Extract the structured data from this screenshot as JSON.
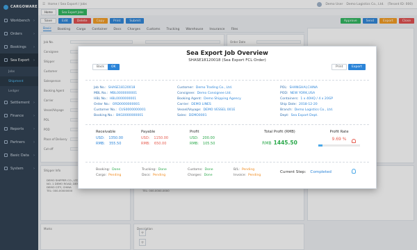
{
  "app": {
    "logo_text": "CARGOWARE"
  },
  "sidebar": {
    "items": [
      {
        "label": "Workbench",
        "active": false
      },
      {
        "label": "Orders",
        "active": false
      },
      {
        "label": "Bookings",
        "active": false
      },
      {
        "label": "Sea Export",
        "active": true
      },
      {
        "label": "Jobs",
        "active": false,
        "sub": true
      },
      {
        "label": "Shipment",
        "active": true,
        "sub": true
      },
      {
        "label": "Ledger",
        "active": false,
        "sub": true
      },
      {
        "label": "Settlement",
        "active": false
      },
      {
        "label": "Finance",
        "active": false
      },
      {
        "label": "Reports",
        "active": false
      },
      {
        "label": "Partners",
        "active": false
      },
      {
        "label": "Basic Data",
        "active": false
      },
      {
        "label": "System",
        "active": false
      }
    ]
  },
  "topbar": {
    "breadcrumb": "Home / Sea Export / Jobs",
    "user": "Demo User",
    "company": "Demo Logistics Co., Ltd.",
    "tenant": "(Tenant ID: 000)"
  },
  "tabstrip": {
    "tabs": [
      {
        "label": "Home",
        "active": false
      },
      {
        "label": "Sea Export Jobs",
        "active": true
      }
    ]
  },
  "toolbar": {
    "left": [
      {
        "label": "Save",
        "style": "b-white"
      },
      {
        "label": "Edit",
        "style": "b-blue"
      },
      {
        "label": "Delete",
        "style": "b-red"
      },
      {
        "label": "Copy",
        "style": "b-orange"
      },
      {
        "label": "Print",
        "style": "b-blue"
      },
      {
        "label": "Submit",
        "style": "b-blue"
      }
    ],
    "right": [
      {
        "label": "Approve",
        "style": "b-green"
      },
      {
        "label": "Send",
        "style": "b-blue"
      },
      {
        "label": "Export",
        "style": "b-orange"
      },
      {
        "label": "Close",
        "style": "b-red"
      }
    ]
  },
  "subtabs": [
    "Basic",
    "Booking",
    "Cargo",
    "Container",
    "Docs",
    "Charges",
    "Customs",
    "Trucking",
    "Warehouse",
    "Insurance",
    "Files"
  ],
  "form": {
    "labels": [
      "Job No.",
      "Consignee",
      "Shipper",
      "Customer",
      "Salesperson",
      "Booking Agent",
      "Carrier",
      "Vessel/Voyage",
      "POL",
      "POD",
      "Place of Delivery",
      "Cut-off"
    ],
    "right_labels": [
      "Order Date",
      "Pickup Date",
      "Ship Date",
      "ETA",
      "Terms",
      "Remarks"
    ],
    "shipper_label": "Shipper Info",
    "shipper_text": "DEMO SHIPPER CO., LTD.\nNO. 1 DEMO ROAD, DEMO DISTRICT\nDEMO CITY, CHINA\nTEL: 000-00000000",
    "consignee_label": "Consignee Info",
    "consignee_text": "DEMO CONSIGNEE CO., LTD.\nNO. 2 DEMO STREET\nDEMO CITY, USA\nTEL: 000-0000-0000",
    "notify_label": "Notify Party",
    "notify_text": "SAME AS CONSIGNEE",
    "marks_label": "Marks",
    "desc_label": "Description"
  },
  "modal": {
    "title": "Sea Export Job Overview",
    "subtitle": "SHASE18120018 (Sea Export FCL Order)",
    "back_label": "Back",
    "confirm_label": "OK",
    "print_label": "Print",
    "export_label": "Export",
    "info": {
      "col1": [
        {
          "k": "Job No.:",
          "v": "SHASE18120018"
        },
        {
          "k": "MBL No.:",
          "v": "MBL0000000001"
        },
        {
          "k": "HBL No.:",
          "v": "HBL0000000001"
        },
        {
          "k": "Order No.:",
          "v": "ORD0000000001"
        },
        {
          "k": "Customer No.:",
          "v": "CUS0000000001"
        },
        {
          "k": "Booking No.:",
          "v": "BKG0000000001"
        }
      ],
      "col2": [
        {
          "k": "Customer:",
          "v": "Demo Trading Co., Ltd."
        },
        {
          "k": "Consignee:",
          "v": "Demo Consignee Ltd."
        },
        {
          "k": "Booking Agent:",
          "v": "Demo Shipping Agency"
        },
        {
          "k": "Carrier:",
          "v": "DEMO LINES"
        },
        {
          "k": "Vessel/Voyage:",
          "v": "DEMO VESSEL 001E"
        },
        {
          "k": "Sales:",
          "v": "DEMO0001"
        }
      ],
      "col3": [
        {
          "k": "POL:",
          "v": "SHANGHAI,CHINA"
        },
        {
          "k": "POD:",
          "v": "NEW YORK,USA"
        },
        {
          "k": "Containers:",
          "v": "1 x 40HQ / 4 x 20GP"
        },
        {
          "k": "Ship Date:",
          "v": "2018-12-20"
        },
        {
          "k": "Branch:",
          "v": "Demo Logistics Co., Ltd."
        },
        {
          "k": "Dept:",
          "v": "Sea Export Dept."
        }
      ]
    },
    "finance": {
      "receivable": {
        "title": "Receivable",
        "usd_label": "USD",
        "usd": "1350.00",
        "rmb_label": "RMB",
        "rmb": "355.50"
      },
      "payable": {
        "title": "Payable",
        "usd_label": "USD",
        "usd": "1150.00",
        "rmb_label": "RMB",
        "rmb": "650.00"
      },
      "profit": {
        "title": "Profit",
        "usd_label": "USD",
        "usd": "200.00",
        "rmb_label": "RMB",
        "rmb": "105.50"
      }
    },
    "total_profit": {
      "title": "Total Profit (RMB)",
      "currency": "RMB",
      "value": "1445.50"
    },
    "profit_rate": {
      "title": "Profit Rate",
      "value": "9.69 %",
      "fraction": 0.0969
    },
    "status": [
      [
        {
          "k": "Booking:",
          "v": "Done",
          "c": "c-green"
        },
        {
          "k": "Trucking:",
          "v": "Done",
          "c": "c-green"
        },
        {
          "k": "Customs:",
          "v": "Done",
          "c": "c-green"
        },
        {
          "k": "B/L:",
          "v": "Pending",
          "c": "c-orange"
        }
      ],
      [
        {
          "k": "Cargo:",
          "v": "Pending",
          "c": "c-orange"
        },
        {
          "k": "Docs:",
          "v": "Pending",
          "c": "c-orange"
        },
        {
          "k": "Charges:",
          "v": "Done",
          "c": "c-green"
        },
        {
          "k": "Invoice:",
          "v": "Pending",
          "c": "c-orange"
        }
      ]
    ],
    "progress": {
      "label": "Current Step:",
      "value": "Completed"
    }
  }
}
